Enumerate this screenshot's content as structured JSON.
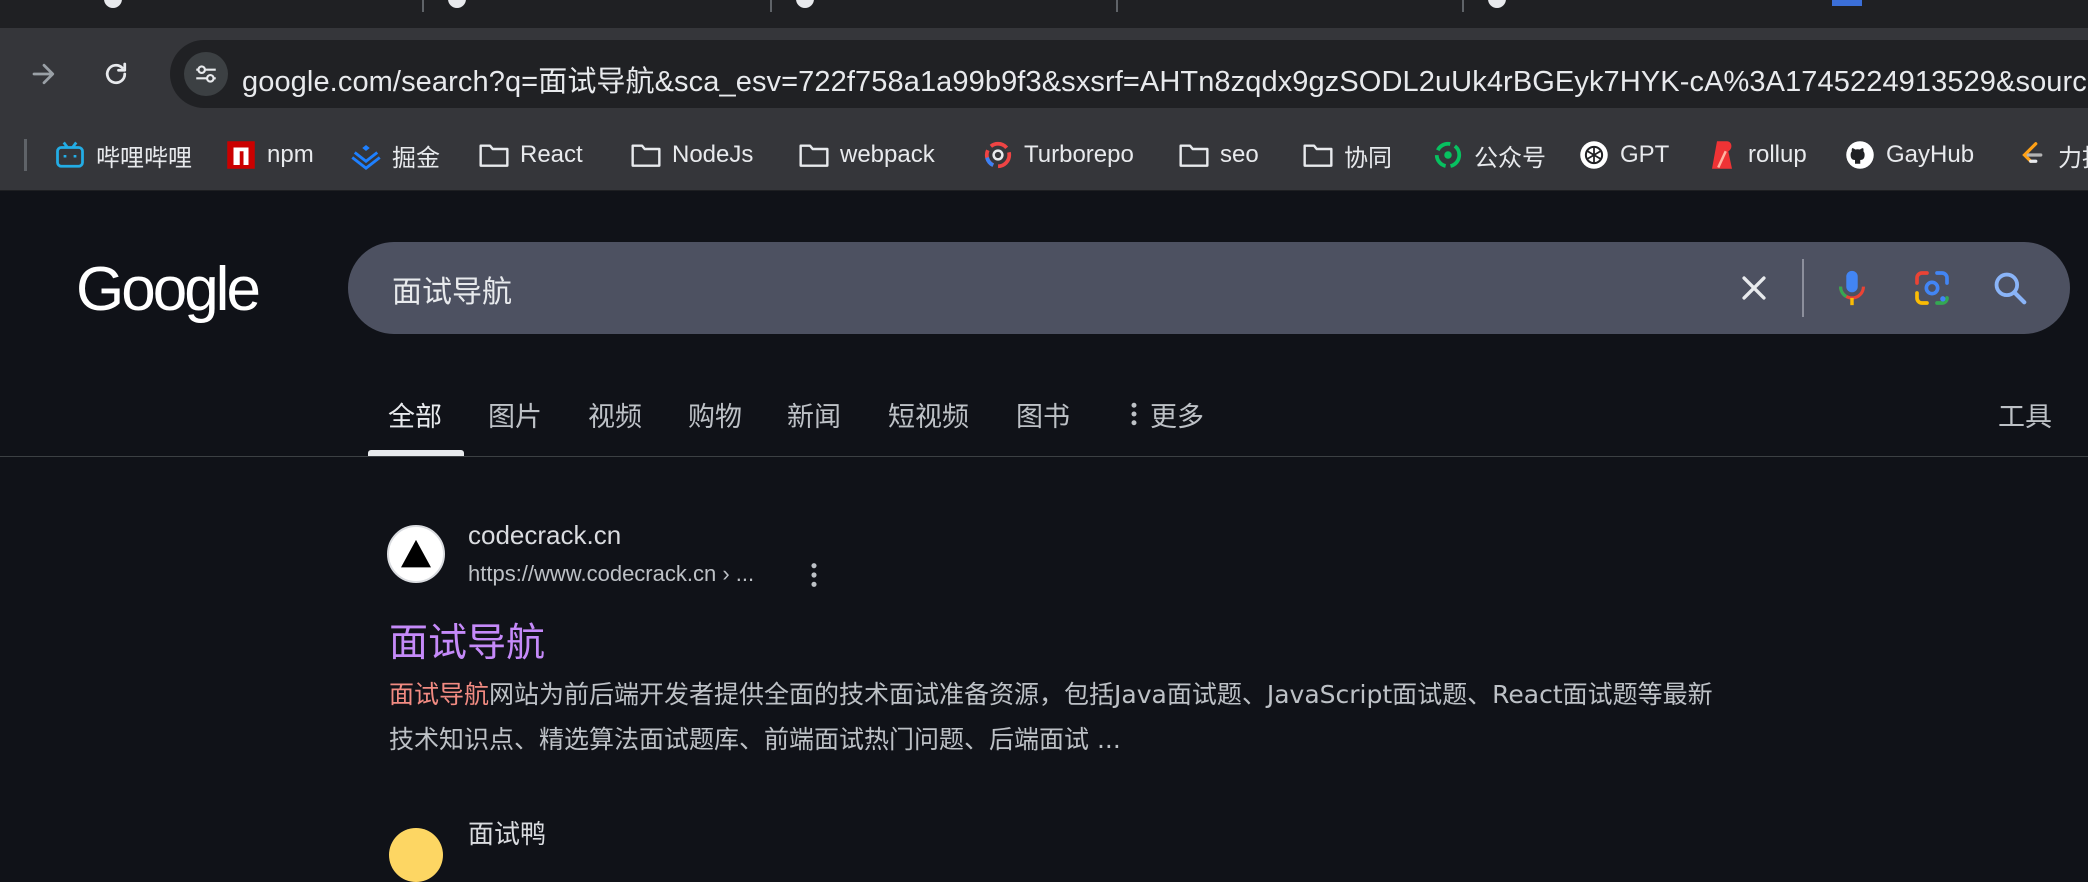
{
  "browser": {
    "url": "google.com/search?q=面试导航&sca_esv=722f758a1a99b9f3&sxsrf=AHTn8zqdx9gzSODL2uUk4rBGEyk7HYK-cA%3A1745224913529&source",
    "forward_icon": "arrow-right-icon",
    "reload_icon": "reload-icon",
    "site_info_icon": "tune-icon"
  },
  "bookmarks": [
    {
      "label": "哔哩哔哩",
      "icon": "bilibili-icon"
    },
    {
      "label": "npm",
      "icon": "npm-icon"
    },
    {
      "label": "掘金",
      "icon": "juejin-icon"
    },
    {
      "label": "React",
      "icon": "folder-icon"
    },
    {
      "label": "NodeJs",
      "icon": "folder-icon"
    },
    {
      "label": "webpack",
      "icon": "folder-icon"
    },
    {
      "label": "Turborepo",
      "icon": "turborepo-icon"
    },
    {
      "label": "seo",
      "icon": "folder-icon"
    },
    {
      "label": "协同",
      "icon": "folder-icon"
    },
    {
      "label": "公众号",
      "icon": "wechat-official-icon"
    },
    {
      "label": "GPT",
      "icon": "openai-icon"
    },
    {
      "label": "rollup",
      "icon": "rollup-icon"
    },
    {
      "label": "GayHub",
      "icon": "github-icon"
    },
    {
      "label": "力扣",
      "icon": "leetcode-icon"
    }
  ],
  "search": {
    "logo": "Google",
    "query": "面试导航"
  },
  "tabs": [
    {
      "label": "全部",
      "active": true
    },
    {
      "label": "图片"
    },
    {
      "label": "视频"
    },
    {
      "label": "购物"
    },
    {
      "label": "新闻"
    },
    {
      "label": "短视频"
    },
    {
      "label": "图书"
    },
    {
      "label": "更多"
    }
  ],
  "tools_label": "工具",
  "results": [
    {
      "site": "codecrack.cn",
      "url": "https://www.codecrack.cn › ...",
      "title": "面试导航",
      "snippet_highlight": "面试导航",
      "snippet_rest": "网站为前后端开发者提供全面的技术面试准备资源，包括Java面试题、JavaScript面试题、React面试题等最新技术知识点、精选算法面试题库、前端面试热门问题、后端面试 ..."
    },
    {
      "site": "面试鸭"
    }
  ],
  "colors": {
    "page_bg": "#101218",
    "searchbox_bg": "#4d5161",
    "visited_link": "#c58af9",
    "highlight": "#f28b82"
  }
}
